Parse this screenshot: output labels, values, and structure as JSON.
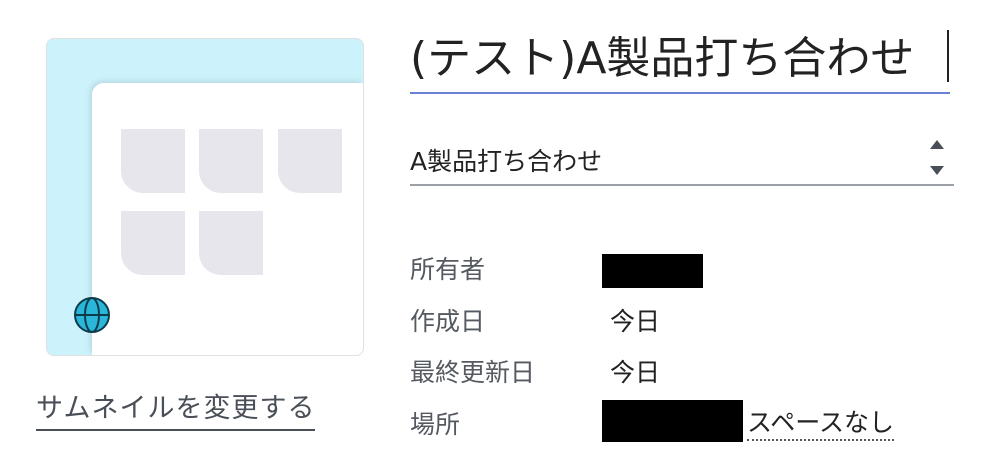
{
  "thumbnail": {
    "change_label": "サムネイルを変更する"
  },
  "title": {
    "value": "(テスト)A製品打ち合わせ"
  },
  "template_select": {
    "selected": "A製品打ち合わせ"
  },
  "properties": {
    "owner_label": "所有者",
    "created_label": "作成日",
    "created_value": "今日",
    "modified_label": "最終更新日",
    "modified_value": "今日",
    "location_label": "場所",
    "location_value": "スペースなし"
  },
  "colors": {
    "accent_underline": "#6b80d6",
    "thumb_bg": "#ccf2fb",
    "globe": "#29b6d9"
  },
  "icons": {
    "thumbnail_globe": "globe-icon",
    "select_arrows": "sort-arrows-icon"
  }
}
